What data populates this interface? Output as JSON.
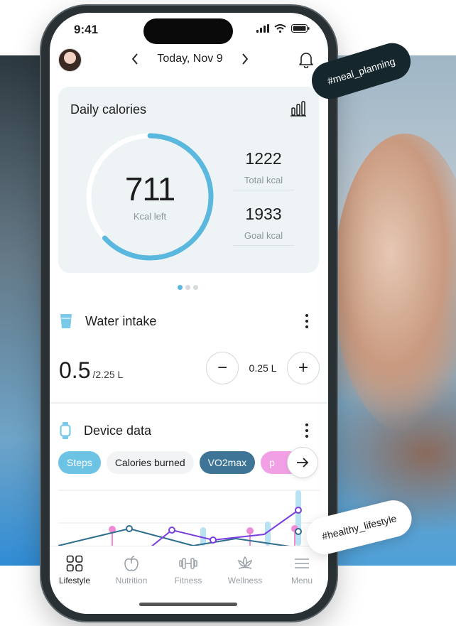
{
  "status_bar": {
    "time": "9:41"
  },
  "header": {
    "date": "Today, Nov 9",
    "prev_label": "‹",
    "next_label": "›"
  },
  "calories": {
    "title": "Daily calories",
    "left_value": "711",
    "left_label": "Kcal left",
    "total_value": "1222",
    "total_label": "Total kcal",
    "goal_value": "1933",
    "goal_label": "Goal kcal",
    "progress_fraction": 0.632
  },
  "pager": {
    "count": 3,
    "active": 0
  },
  "water": {
    "title": "Water intake",
    "value": "0.5",
    "goal": "/2.25 L",
    "step": "0.25 L",
    "minus_label": "−",
    "plus_label": "+"
  },
  "device": {
    "title": "Device data",
    "chips": [
      "Steps",
      "Calories burned",
      "VO2max",
      "p"
    ],
    "arrow_label": "→"
  },
  "tabs": [
    {
      "label": "Lifestyle",
      "icon": "grid-icon",
      "active": true
    },
    {
      "label": "Nutrition",
      "icon": "apple-icon",
      "active": false
    },
    {
      "label": "Fitness",
      "icon": "dumbbell-icon",
      "active": false
    },
    {
      "label": "Wellness",
      "icon": "lotus-icon",
      "active": false
    },
    {
      "label": "Menu",
      "icon": "hamburger-icon",
      "active": false
    }
  ],
  "tags": {
    "meal": "#meal_planning",
    "healthy": "#healthy_lifestyle"
  },
  "colors": {
    "accent": "#5ab7de",
    "dark": "#3e7596",
    "purple": "#7a3ee0",
    "pink": "#f08ad6"
  }
}
